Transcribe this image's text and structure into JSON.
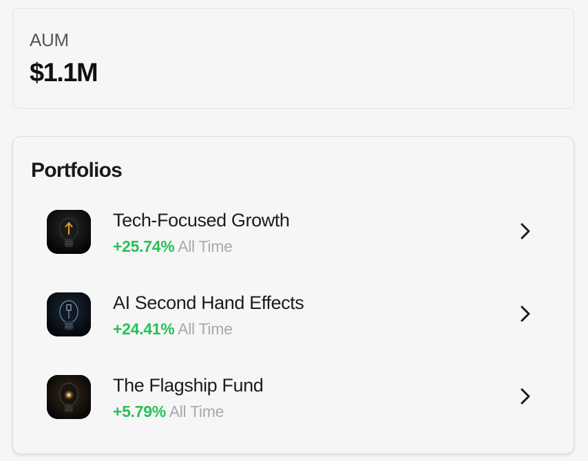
{
  "aum": {
    "label": "AUM",
    "value": "$1.1M"
  },
  "portfolios": {
    "title": "Portfolios",
    "items": [
      {
        "name": "Tech-Focused Growth",
        "return_pct": "+25.74%",
        "return_period": "All Time",
        "icon": "lightbulb-arrow-icon"
      },
      {
        "name": "AI Second Hand Effects",
        "return_pct": "+24.41%",
        "return_period": "All Time",
        "icon": "lightbulb-blue-icon"
      },
      {
        "name": "The Flagship Fund",
        "return_pct": "+5.79%",
        "return_period": "All Time",
        "icon": "lightbulb-glow-icon"
      }
    ]
  },
  "colors": {
    "positive": "#27c157",
    "muted": "#a9a9a9"
  }
}
